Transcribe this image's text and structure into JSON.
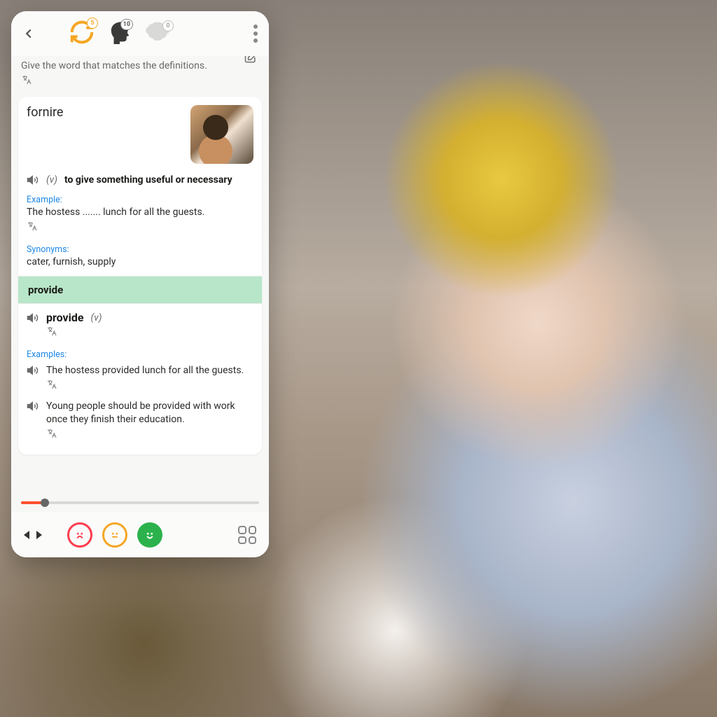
{
  "header": {
    "badges": {
      "refresh": "5",
      "head": "10",
      "brain": "0"
    }
  },
  "prompt": "Give the word that matches the definitions.",
  "card": {
    "word": "fornire",
    "pos": "(v)",
    "definition": "to give something useful or necessary",
    "example_label": "Example:",
    "example": "The hostess ....... lunch for all the guests.",
    "synonyms_label": "Synonyms:",
    "synonyms": "cater, furnish, supply"
  },
  "answer": "provide",
  "detail": {
    "word": "provide",
    "pos": "(v)",
    "examples_label": "Examples:",
    "examples": [
      "The hostess provided lunch for all the guests.",
      "Young people should be provided with work once they finish their education."
    ]
  }
}
